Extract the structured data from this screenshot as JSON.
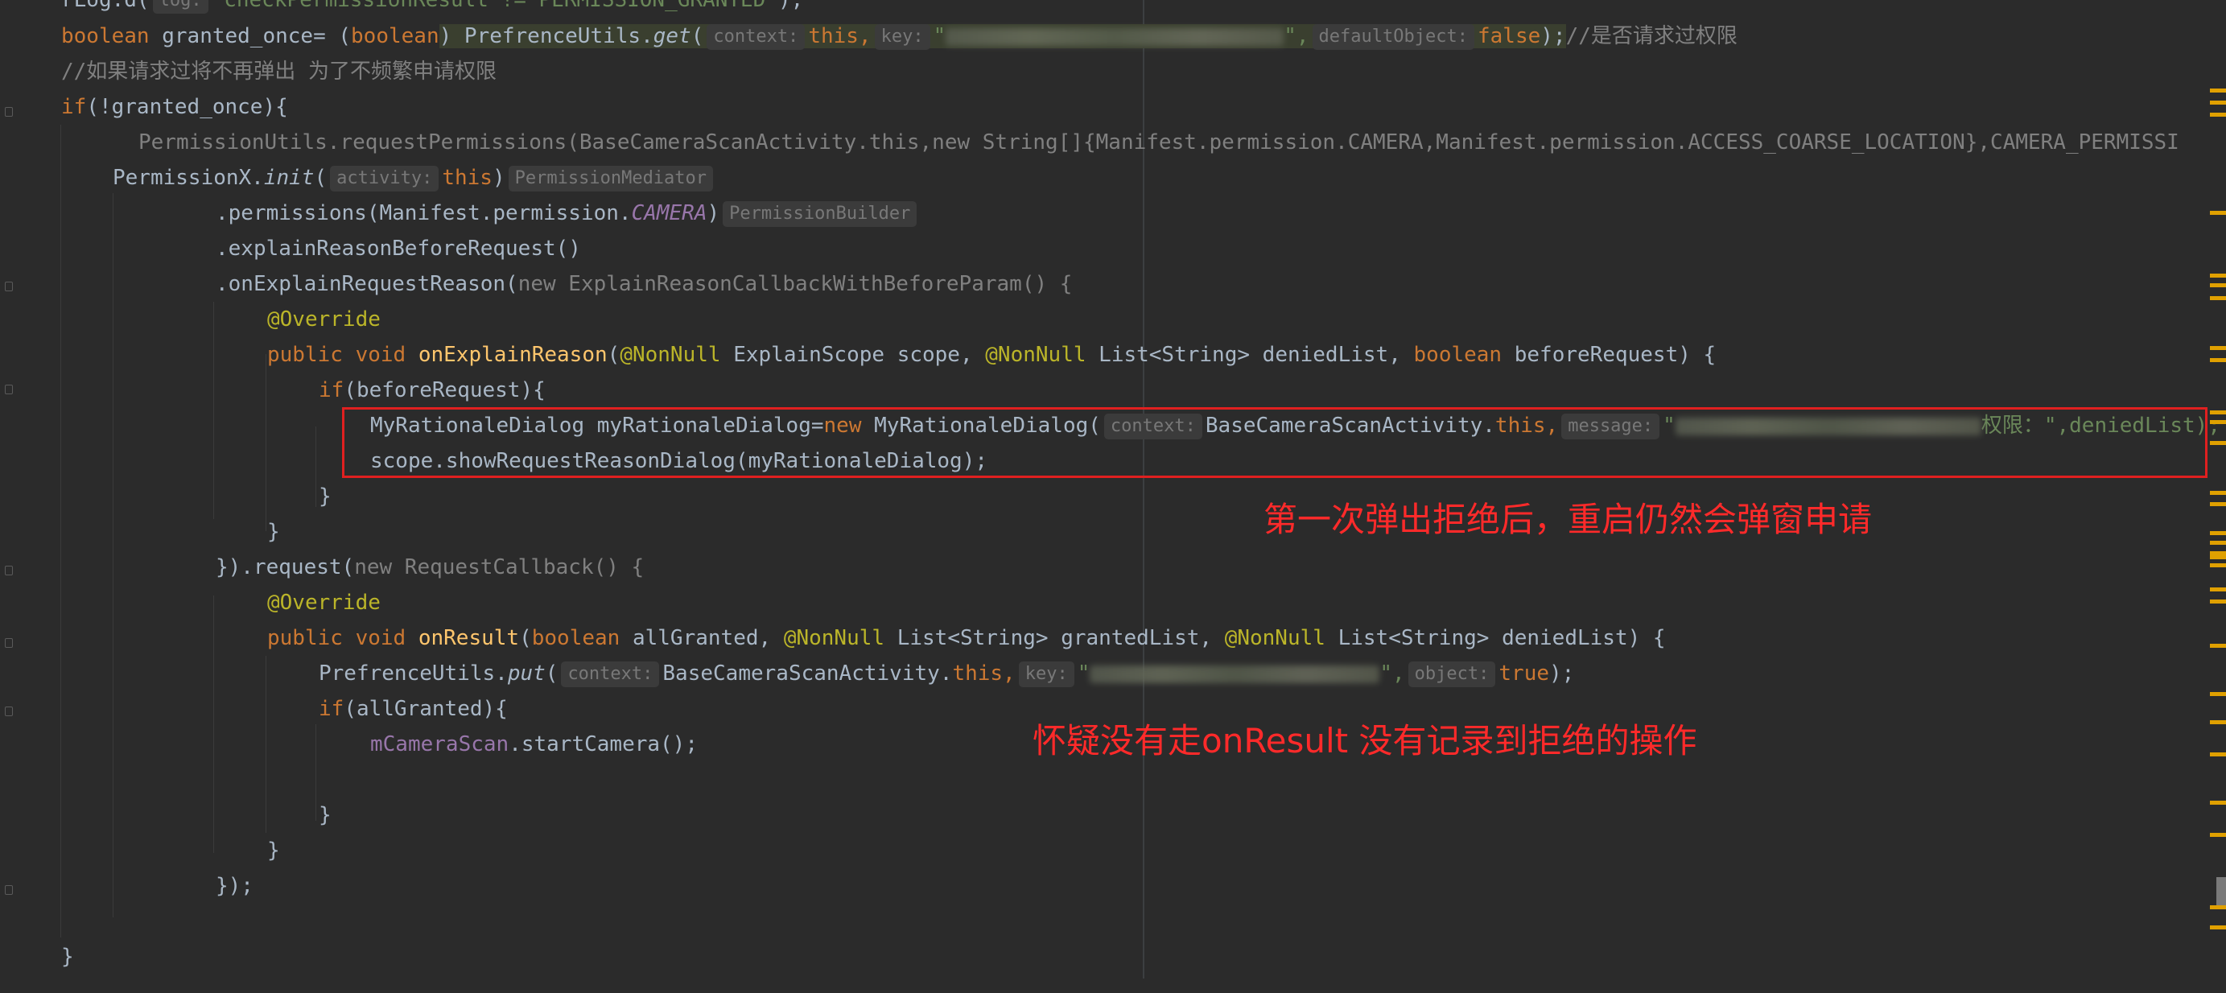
{
  "editor": {
    "lines": {
      "l1_prefix": "rLog.d(",
      "l1_hint": "log:",
      "l1_str": "\"checkPermissionResult != PERMISSION_GRANTED\"",
      "l1_end": ");",
      "l2_kw": "boolean",
      "l2_a": " granted_once= (",
      "l2_kw2": "boolean",
      "l2_b": ") PrefrenceUtils.",
      "l2_fn": "get",
      "l2_paren": "(",
      "l2_h1": "context:",
      "l2_this": "this,",
      "l2_h2": "key:",
      "l2_keyq": "\"",
      "l2_keyq2": "\",",
      "l2_h3": "defaultObject:",
      "l2_false": "false",
      "l2_end": ");",
      "l2_cmt": "//是否请求过权限",
      "l3_cmt": "//如果请求过将不再弹出 为了不频繁申请权限",
      "l4_kw": "if",
      "l4_rest": "(!granted_once){",
      "l5_text": "PermissionUtils.requestPermissions(BaseCameraScanActivity.this,new String[]{Manifest.permission.CAMERA,Manifest.permission.ACCESS_COARSE_LOCATION},CAMERA_PERMISSI",
      "l6_a": "PermissionX.",
      "l6_fn": "init",
      "l6_paren": "(",
      "l6_h1": "activity:",
      "l6_this": "this",
      "l6_close": ")",
      "l6_hint": "PermissionMediator",
      "l7_a": ".permissions(Manifest.permission.",
      "l7_const": "CAMERA",
      "l7_close": ")",
      "l7_hint": "PermissionBuilder",
      "l8_a": ".explainReasonBeforeRequest()",
      "l9_a": ".onExplainRequestReason(",
      "l9_new": "new ExplainReasonCallbackWithBeforeParam() {",
      "l10_ann": "@Override",
      "l11_kw": "public void",
      "l11_fn": "onExplainReason",
      "l11_a": "(",
      "l11_ann1": "@NonNull",
      "l11_b": " ExplainScope scope, ",
      "l11_ann2": "@NonNull",
      "l11_c": " List<String> deniedList, ",
      "l11_kw2": "boolean",
      "l11_d": " beforeRequest) {",
      "l12_kw": "if",
      "l12_rest": "(beforeRequest){",
      "l13_a": "MyRationaleDialog myRationaleDialog=",
      "l13_new": "new",
      "l13_b": " MyRationaleDialog(",
      "l13_h1": "context:",
      "l13_c": "BaseCameraScanActivity.",
      "l13_this": "this,",
      "l13_h2": "message:",
      "l13_q": "\"",
      "l13_tail": "权限：\",deniedList);",
      "l14_a": "scope.showRequestReasonDialog(myRationaleDialog);",
      "l15": "}",
      "l16": "}",
      "l17_a": "}).request(",
      "l17_new": "new RequestCallback() {",
      "l18_ann": "@Override",
      "l19_kw": "public void",
      "l19_fn": "onResult",
      "l19_a": "(",
      "l19_kw2": "boolean",
      "l19_b": " allGranted, ",
      "l19_ann1": "@NonNull",
      "l19_c": " List<String> grantedList, ",
      "l19_ann2": "@NonNull",
      "l19_d": " List<String> deniedList) {",
      "l20_a": "PrefrenceUtils.",
      "l20_fn": "put",
      "l20_paren": "(",
      "l20_h1": "context:",
      "l20_b": "BaseCameraScanActivity.",
      "l20_this": "this,",
      "l20_h2": "key:",
      "l20_q": "\"",
      "l20_q2": "\",",
      "l20_h3": "object:",
      "l20_true": "true",
      "l20_end": ");",
      "l21_kw": "if",
      "l21_rest": "(allGranted){",
      "l22_fld": "mCameraScan",
      "l22_rest": ".startCamera();",
      "l24": "}",
      "l25": "}",
      "l26": "});",
      "l28": "}"
    }
  },
  "annotations": {
    "note1": "第一次弹出拒绝后，重启仍然会弹窗申请",
    "note2": "怀疑没有走onResult 没有记录到拒绝的操作"
  },
  "colors": {
    "background": "#2b2b2b",
    "annotation": "#ff2a2a"
  }
}
